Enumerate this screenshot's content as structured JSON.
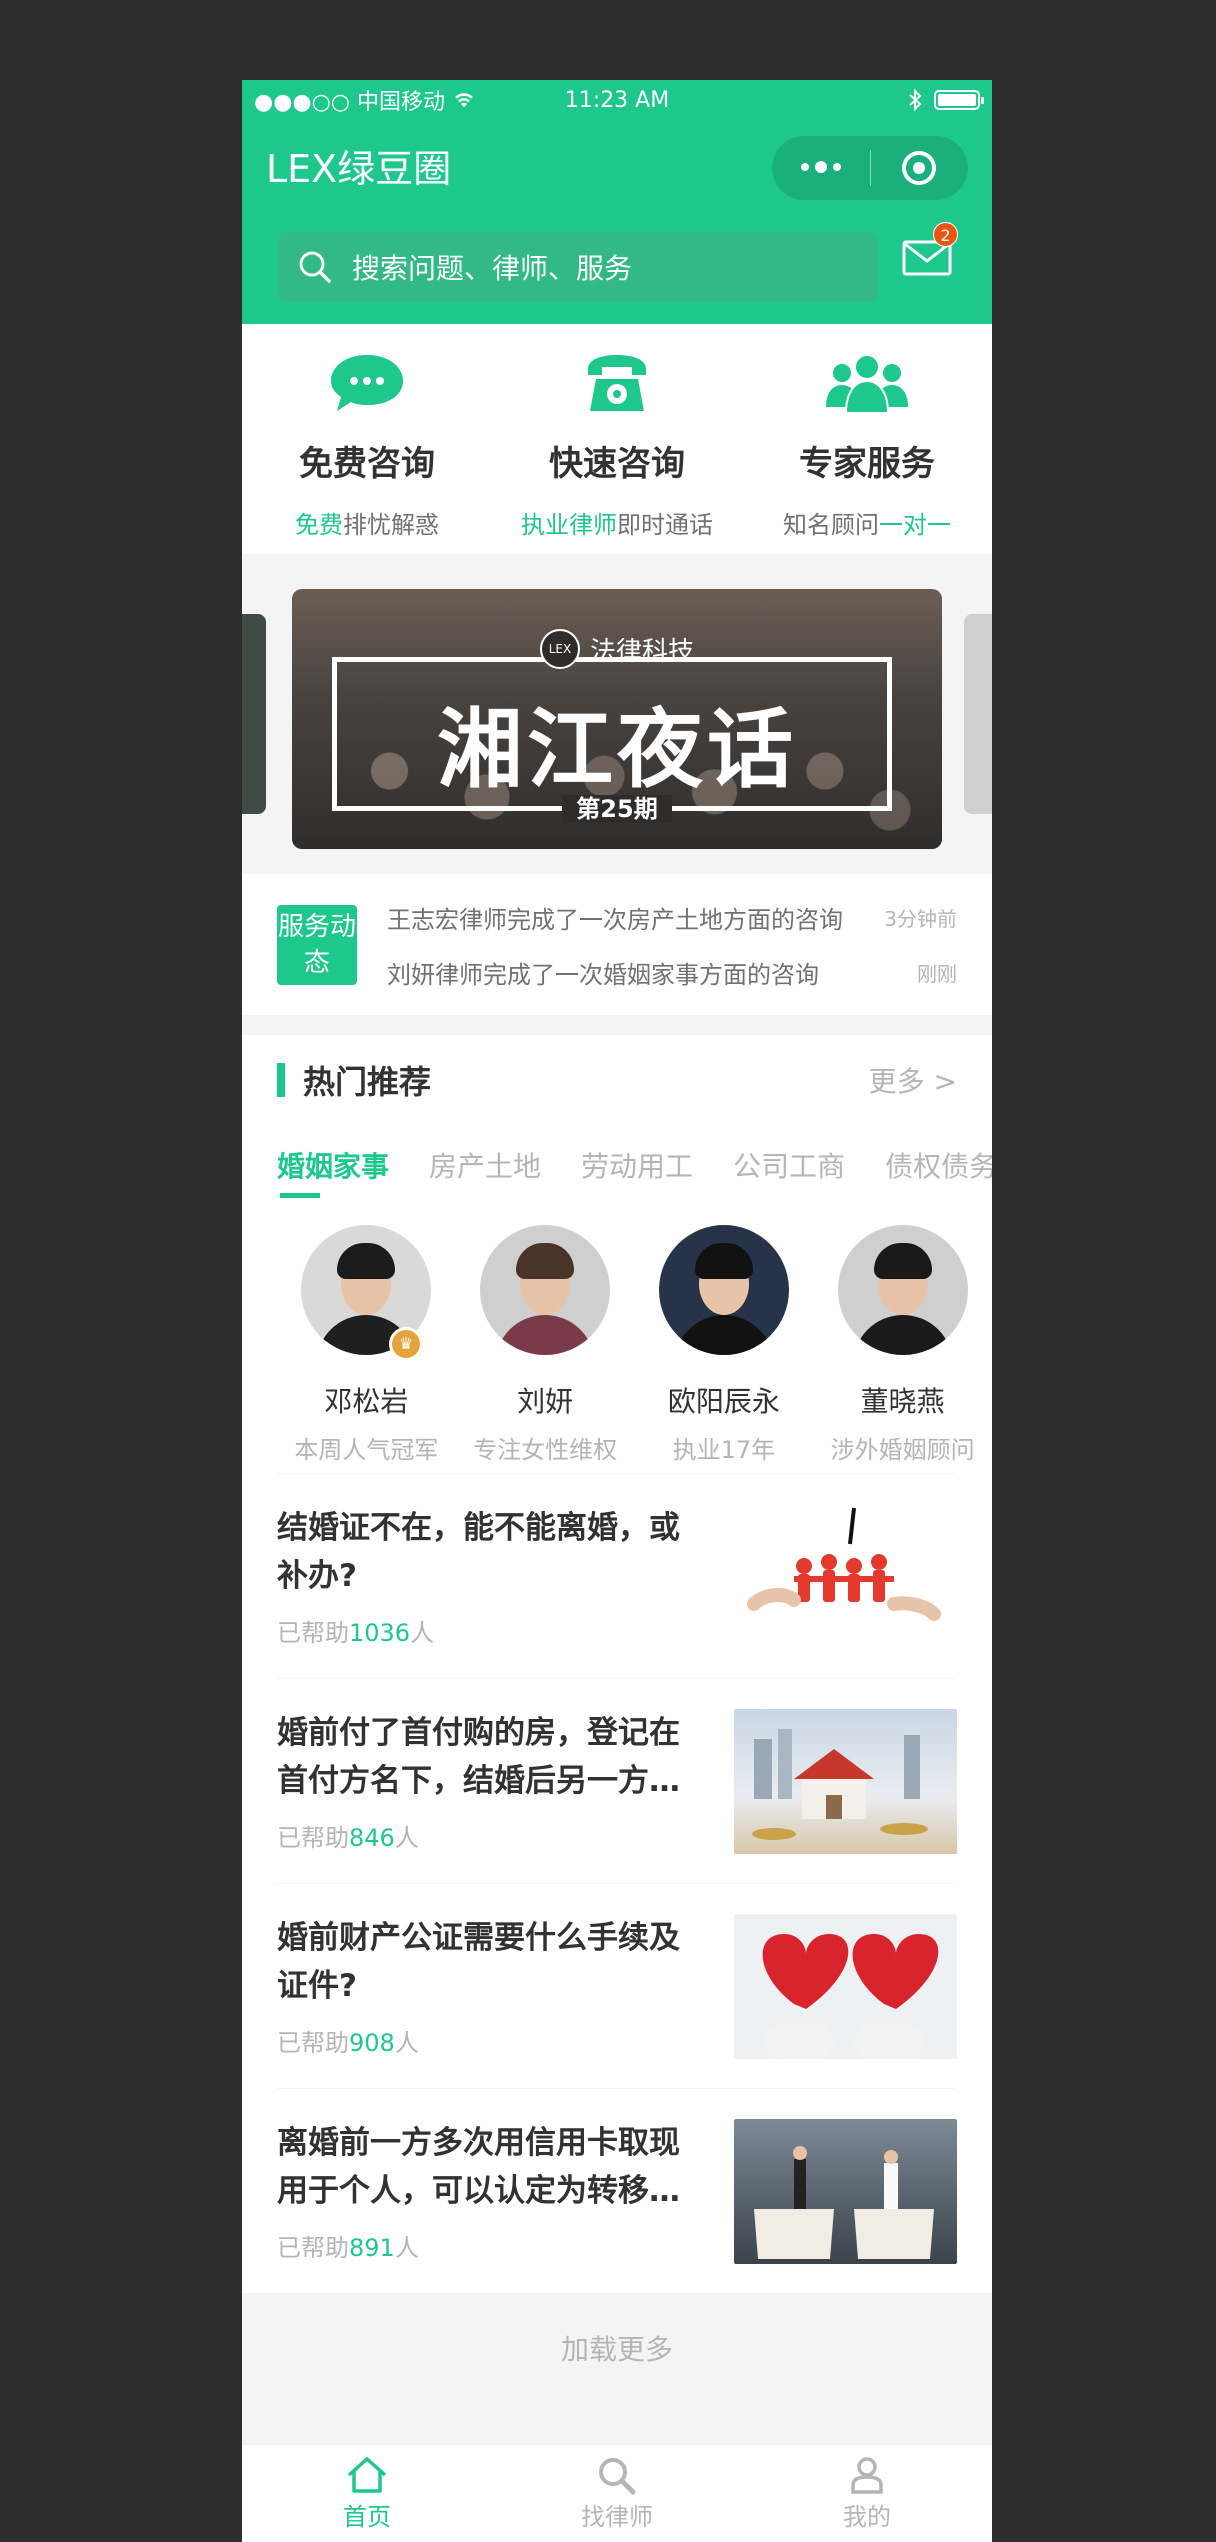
{
  "status": {
    "carrier": "●●●○○ 中国移动",
    "time": "11:23 AM"
  },
  "nav": {
    "title": "LEX绿豆圈"
  },
  "search": {
    "placeholder": "搜索问题、律师、服务",
    "badge": "2"
  },
  "services": [
    {
      "name": "免费咨询",
      "desc_hi": "免费",
      "desc_rest": "排忧解惑"
    },
    {
      "name": "快速咨询",
      "desc_hi": "执业律师",
      "desc_rest": "即时通话"
    },
    {
      "name": "专家服务",
      "desc_rest": "知名顾问",
      "desc_hi": "一对一"
    }
  ],
  "banner": {
    "brand": "法律科技",
    "brand_logo": "LEX",
    "title": "湘江夜话",
    "issue": "第25期"
  },
  "dynamics": {
    "tag": "服务动态",
    "items": [
      {
        "text": "王志宏律师完成了一次房产土地方面的咨询",
        "time": "3分钟前"
      },
      {
        "text": "刘妍律师完成了一次婚姻家事方面的咨询",
        "time": "刚刚"
      }
    ]
  },
  "hot": {
    "title": "热门推荐",
    "more": "更多 >",
    "tabs": [
      "婚姻家事",
      "房产土地",
      "劳动用工",
      "公司工商",
      "债权债务"
    ],
    "lawyers": [
      {
        "name": "邓松岩",
        "desc": "本周人气冠军"
      },
      {
        "name": "刘妍",
        "desc": "专注女性维权"
      },
      {
        "name": "欧阳辰永",
        "desc": "执业17年"
      },
      {
        "name": "董晓燕",
        "desc": "涉外婚姻顾问"
      }
    ]
  },
  "articles": [
    {
      "title": "结婚证不在，能不能离婚，或补办?",
      "helped_prefix": "已帮助",
      "count": "1036",
      "helped_suffix": "人"
    },
    {
      "title": "婚前付了首付购的房，登记在首付方名下，结婚后另一方…",
      "helped_prefix": "已帮助",
      "count": "846",
      "helped_suffix": "人"
    },
    {
      "title": "婚前财产公证需要什么手续及证件?",
      "helped_prefix": "已帮助",
      "count": "908",
      "helped_suffix": "人"
    },
    {
      "title": "离婚前一方多次用信用卡取现用于个人，可以认定为转移…",
      "helped_prefix": "已帮助",
      "count": "891",
      "helped_suffix": "人"
    }
  ],
  "load_more": "加载更多",
  "tabbar": [
    {
      "label": "首页",
      "icon": "home-icon",
      "active": true
    },
    {
      "label": "找律师",
      "icon": "search-icon",
      "active": false
    },
    {
      "label": "我的",
      "icon": "user-icon",
      "active": false
    }
  ],
  "colors": {
    "primary": "#1ec88c",
    "search_bg": "#32b987",
    "badge": "#ea5514",
    "title_text": "#323232",
    "body_text": "#717171",
    "muted_text": "#b5b5b6",
    "page_bg": "#f4f4f4"
  }
}
